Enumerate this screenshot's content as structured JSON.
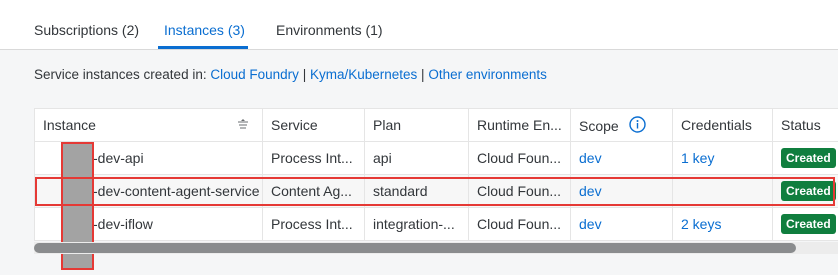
{
  "tabs": [
    {
      "label": "Subscriptions (2)",
      "active": false
    },
    {
      "label": "Instances (3)",
      "active": true
    },
    {
      "label": "Environments (1)",
      "active": false
    }
  ],
  "info": {
    "prefix": "Service instances created in:",
    "links": [
      "Cloud Foundry",
      "Kyma/Kubernetes",
      "Other environments"
    ],
    "separator": "|"
  },
  "table": {
    "columns": [
      "Instance",
      "Service",
      "Plan",
      "Runtime En...",
      "Scope",
      "Credentials",
      "Status"
    ],
    "rows": [
      {
        "instance": "-dev-api",
        "service": "Process Int...",
        "plan": "api",
        "runtime": "Cloud Foun...",
        "scope": "dev",
        "credentials": "1 key",
        "status": "Created"
      },
      {
        "instance": "-dev-content-agent-service",
        "service": "Content Ag...",
        "plan": "standard",
        "runtime": "Cloud Foun...",
        "scope": "dev",
        "credentials": "",
        "status": "Created"
      },
      {
        "instance": "-dev-iflow",
        "service": "Process Int...",
        "plan": "integration-...",
        "runtime": "Cloud Foun...",
        "scope": "dev",
        "credentials": "2 keys",
        "status": "Created"
      }
    ]
  },
  "icons": {
    "sort": "sort-icon",
    "scope_info": "info-circle-icon"
  },
  "colors": {
    "accent": "#0a6ed1",
    "status_created": "#107e3e",
    "highlight_outline": "#e53935"
  }
}
